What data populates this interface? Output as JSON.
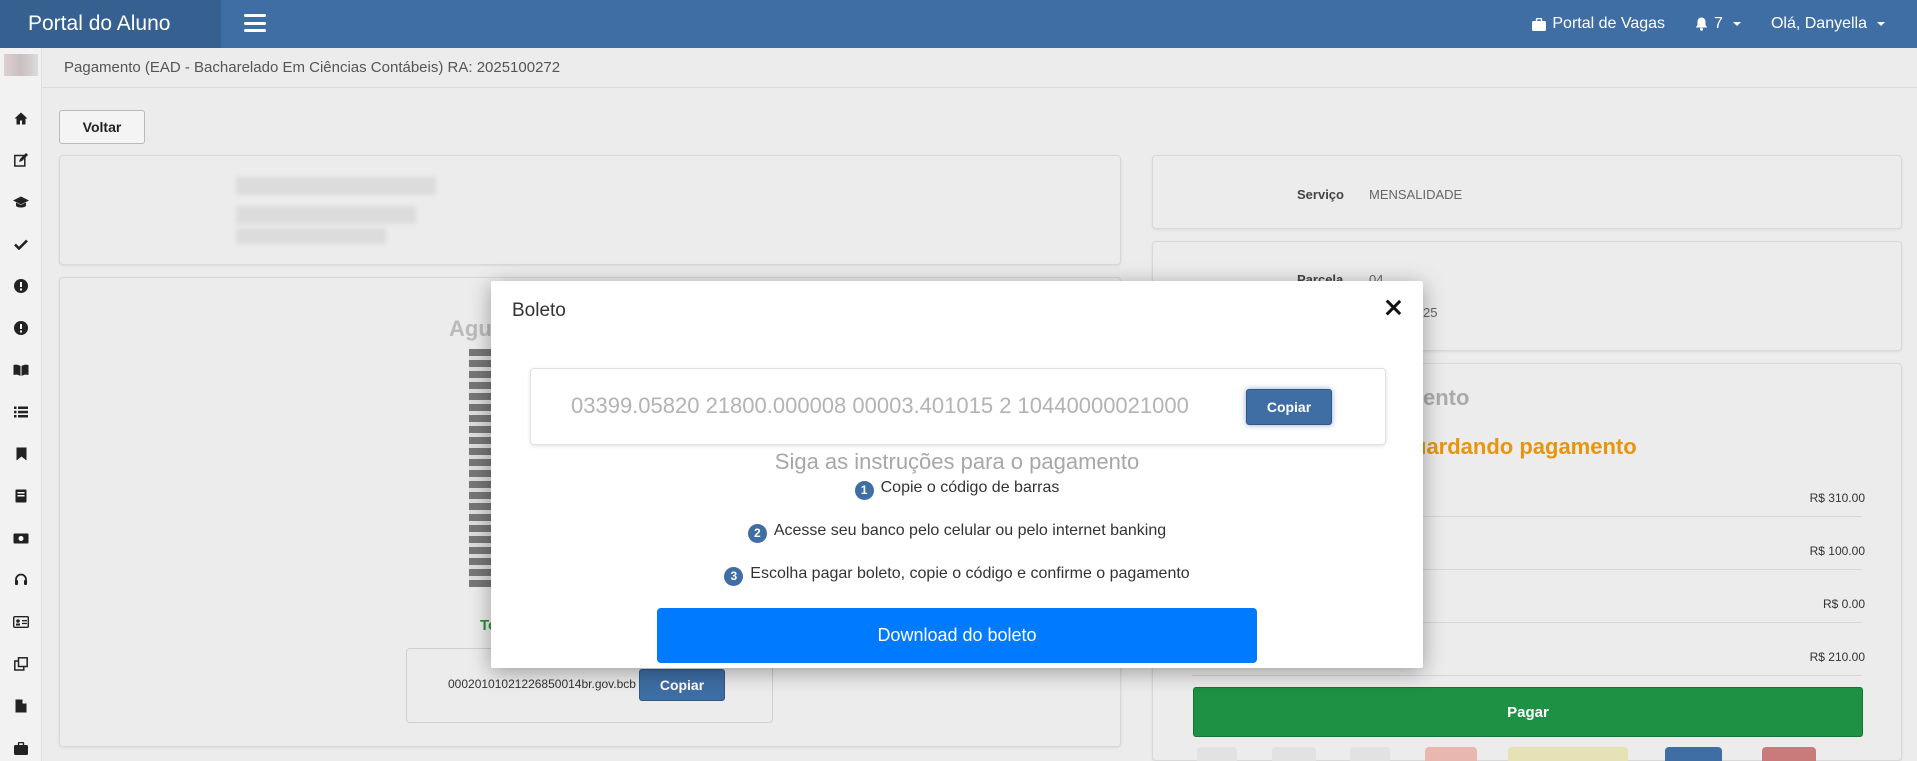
{
  "header": {
    "brand": "Portal do Aluno",
    "portal_vagas": "Portal de Vagas",
    "notifications_count": "7",
    "greeting": "Olá, Danyella"
  },
  "breadcrumb": "Pagamento (EAD - Bacharelado Em Ciências Contábeis) RA: 2025100272",
  "actions": {
    "back_label": "Voltar"
  },
  "pix": {
    "status_partial": "Agu",
    "green_partial": "To",
    "code": "00020101021226850014br.gov.bcb",
    "copy_label": "Copiar"
  },
  "details": {
    "service_label": "Serviço",
    "service_value": "MENSALIDADE",
    "parcela_label": "Parcela",
    "parcela_value": "04",
    "due_partial": "25"
  },
  "payment": {
    "title_partial": "ento",
    "status_partial": "uardando pagamento",
    "amounts": [
      "R$ 310.00",
      "R$ 100.00",
      "R$ 0.00",
      "R$ 210.00"
    ],
    "pay_label": "Pagar"
  },
  "modal": {
    "title": "Boleto",
    "barcode": "03399.05820 21800.000008 00003.401015 2 10440000021000",
    "copy_label": "Copiar",
    "instructions_title": "Siga as instruções para o pagamento",
    "steps": [
      {
        "num": "1",
        "text": "Copie o código de barras"
      },
      {
        "num": "2",
        "text": "Acesse seu banco pelo celular ou pelo internet banking"
      },
      {
        "num": "3",
        "text": "Escolha pagar boleto, copie o código e confirme o pagamento"
      }
    ],
    "download_label": "Download do boleto"
  },
  "colors": {
    "header": "#3f6ea5",
    "brand_bg": "#35608f",
    "primary_button": "#007bff",
    "pay_green": "#1e9145",
    "status_orange": "#e8950e"
  },
  "sidebar_icons": [
    "home-icon",
    "edit-icon",
    "graduation-cap-icon",
    "check-icon",
    "alert-icon",
    "alert-icon",
    "book-open-icon",
    "list-icon",
    "bookmark-icon",
    "book-icon",
    "money-icon",
    "support-icon",
    "id-card-icon",
    "copy-icon",
    "file-icon",
    "briefcase-icon"
  ]
}
